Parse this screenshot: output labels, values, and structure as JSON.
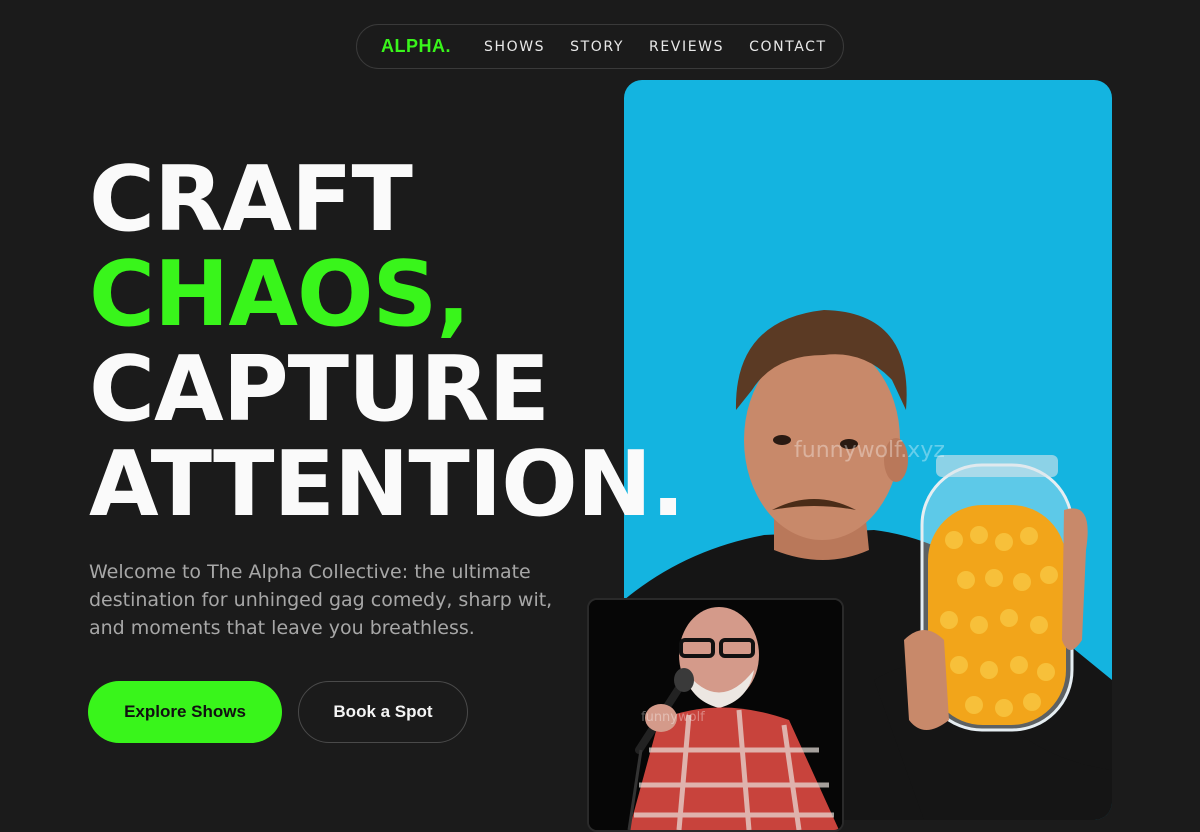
{
  "nav": {
    "logo": "ALPHA.",
    "links": [
      "SHOWS",
      "STORY",
      "REVIEWS",
      "CONTACT"
    ]
  },
  "hero": {
    "lines": [
      "CRAFT",
      "CHAOS,",
      "CAPTURE",
      "ATTENTION."
    ],
    "subtitle": "Welcome to The Alpha Collective: the ultimate destination for unhinged gag comedy, sharp wit, and moments that leave you breathless.",
    "primary_button": "Explore Shows",
    "secondary_button": "Book a Spot"
  },
  "images": {
    "main_watermark": "funnywolf.xyz",
    "small_watermark": "funnywolf"
  },
  "colors": {
    "accent": "#39f51b",
    "background": "#1b1b1b",
    "photo_bg": "#14b4e0"
  }
}
